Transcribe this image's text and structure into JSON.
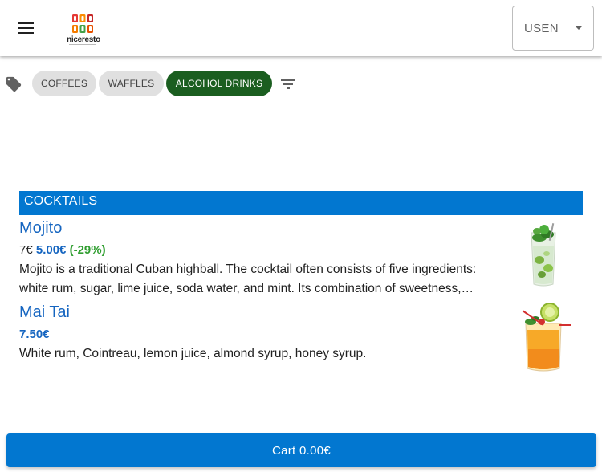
{
  "header": {
    "logo_text": "niceresto",
    "language": "USEN"
  },
  "categories": [
    {
      "label": "COFFEES",
      "active": false
    },
    {
      "label": "WAFFLES",
      "active": false
    },
    {
      "label": "ALCOHOL DRINKS",
      "active": true
    }
  ],
  "section": {
    "title": "COCKTAILS",
    "items": [
      {
        "name": "Mojito",
        "old_price": "7€",
        "price": "5.00€",
        "discount": "(-29%)",
        "desc_line1": "Mojito is a traditional Cuban highball. The cocktail often consists of five ingredients:",
        "desc_line2": "white rum, sugar, lime juice, soda water, and mint. Its combination of sweetness,…"
      },
      {
        "name": "Mai Tai",
        "price": "7.50€",
        "desc_line1": "White rum, Cointreau, lemon juice, almond syrup, honey syrup."
      }
    ]
  },
  "cart": {
    "label": "Cart 0.00€"
  },
  "colors": {
    "accent": "#0277d0",
    "active_chip": "#1b5e20",
    "item_title": "#1565c0",
    "discount": "#2e9d2e"
  },
  "icons": [
    "menu-icon",
    "tag-icon",
    "filter-icon",
    "dropdown-caret-icon"
  ]
}
